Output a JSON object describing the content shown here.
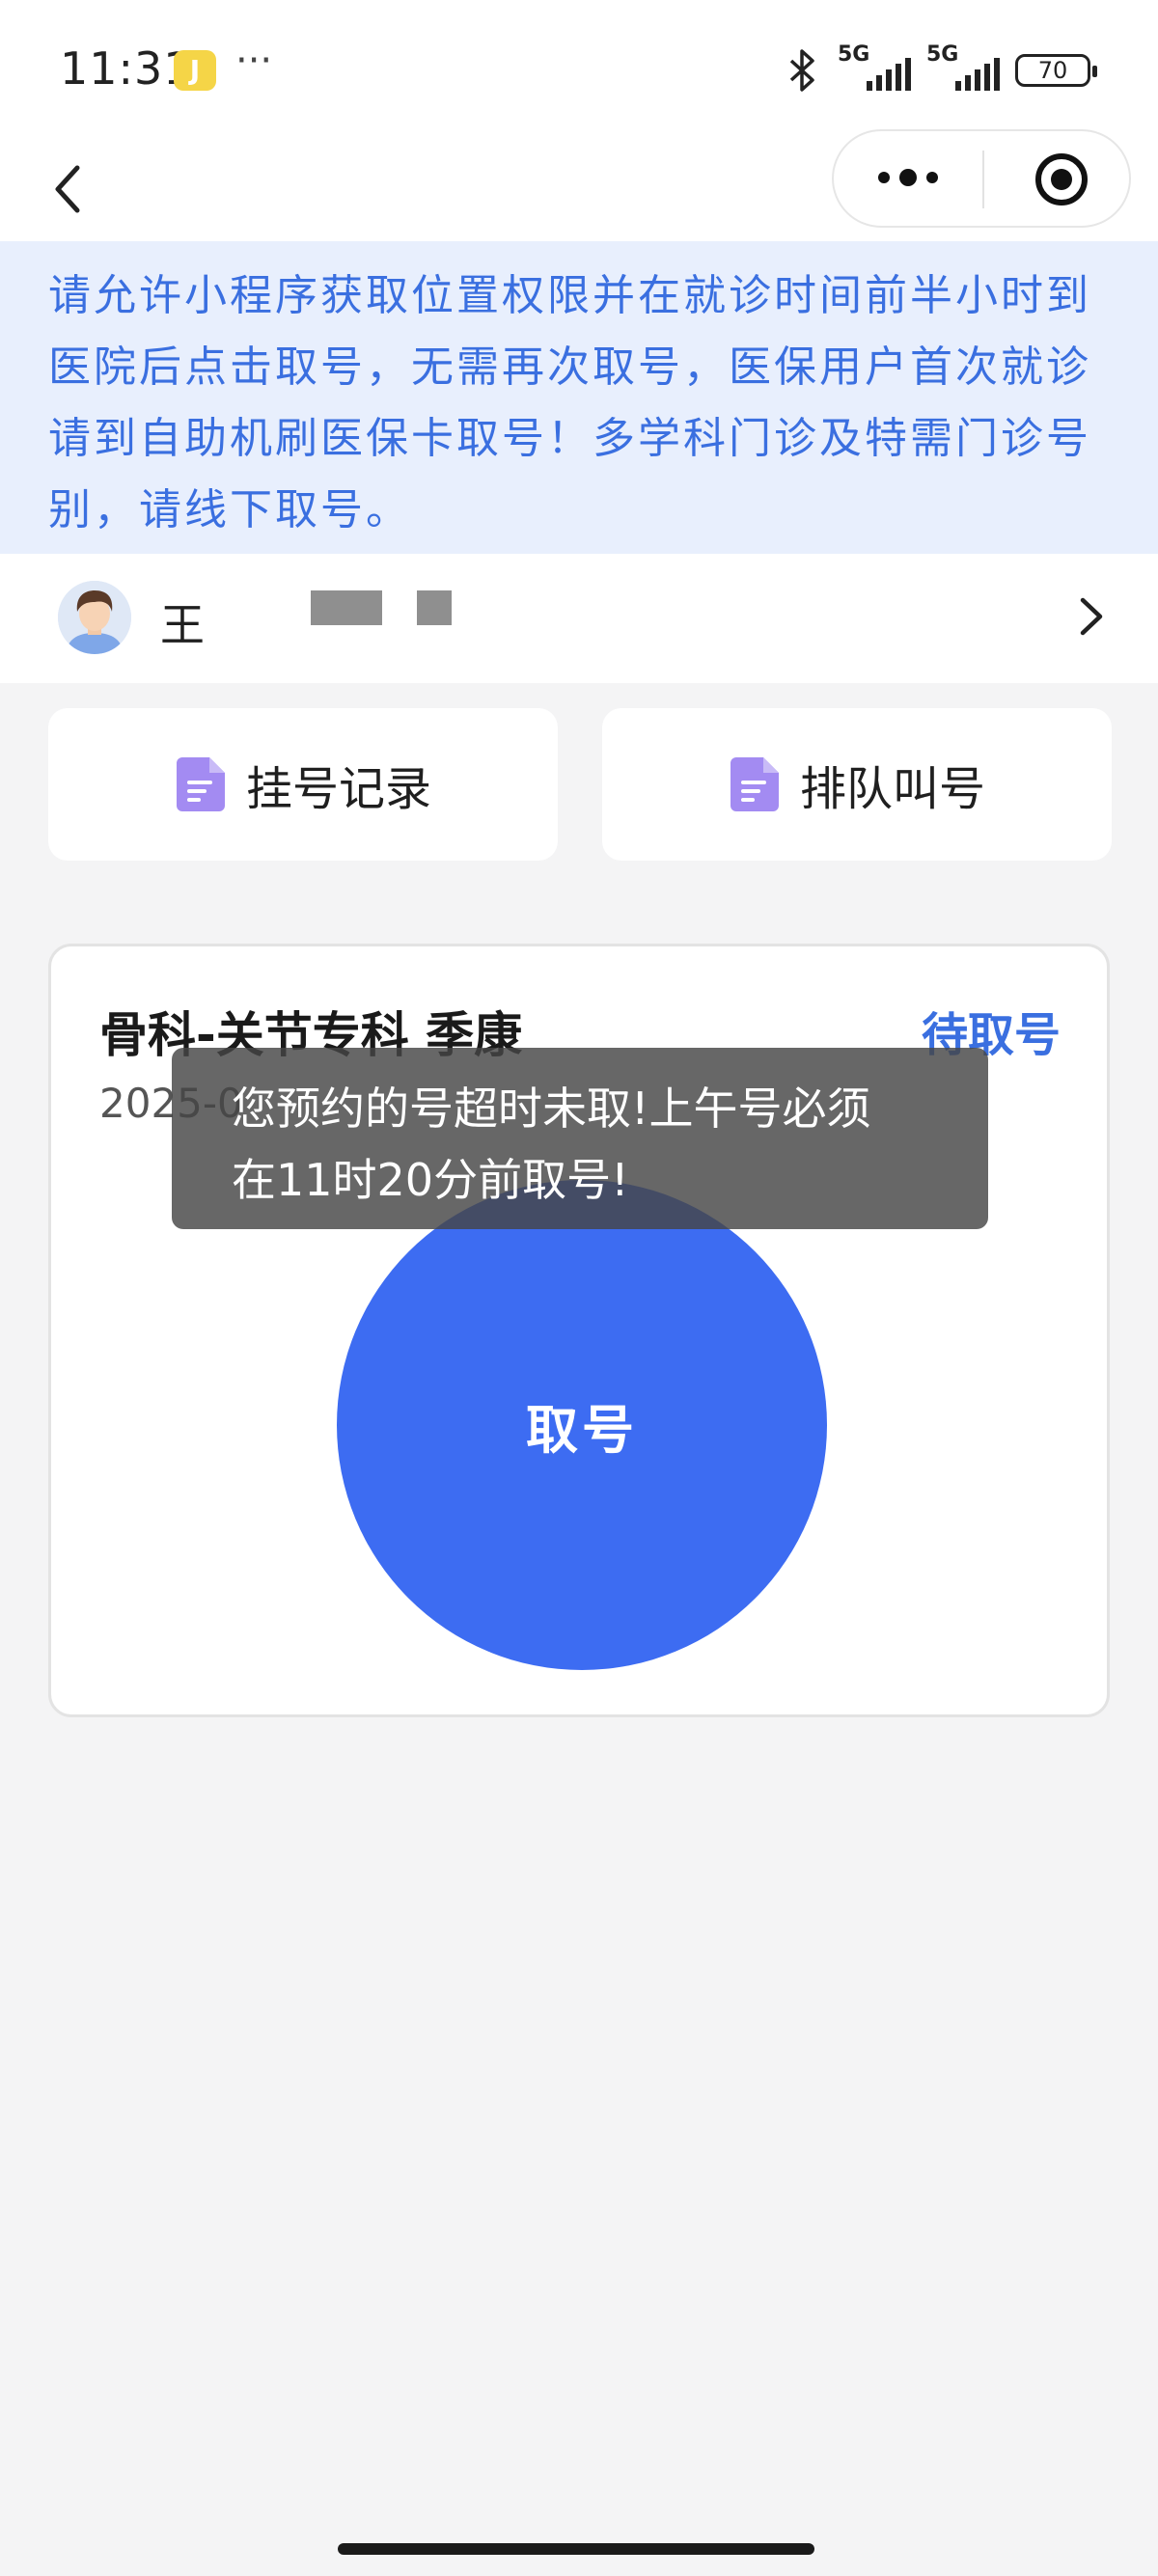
{
  "status_bar": {
    "time": "11:31",
    "notification_badge": "J",
    "more": "···",
    "signal1_label": "5G",
    "signal2_label": "5G",
    "battery": "70"
  },
  "notice": {
    "text": "请允许小程序获取位置权限并在就诊时间前半小时到医院后点击取号，无需再次取号，医保用户首次就诊请到自助机刷医保卡取号！多学科门诊及特需门诊号别，请线下取号。"
  },
  "patient": {
    "name": "王"
  },
  "quick_actions": [
    {
      "label": "挂号记录",
      "icon": "document-icon"
    },
    {
      "label": "排队叫号",
      "icon": "document-icon"
    }
  ],
  "appointment": {
    "department_doctor": "骨科-关节专科 季康",
    "status": "待取号",
    "date_visible": "2025-0",
    "take_number_label": "取号"
  },
  "toast": {
    "line1": "您预约的号超时未取!上午号必须",
    "line2": "在11时20分前取号!"
  },
  "colors": {
    "accent": "#3a6fe0",
    "button": "#3d6cf2",
    "notice_bg": "#e8effd",
    "icon_purple": "#a38bf2"
  }
}
